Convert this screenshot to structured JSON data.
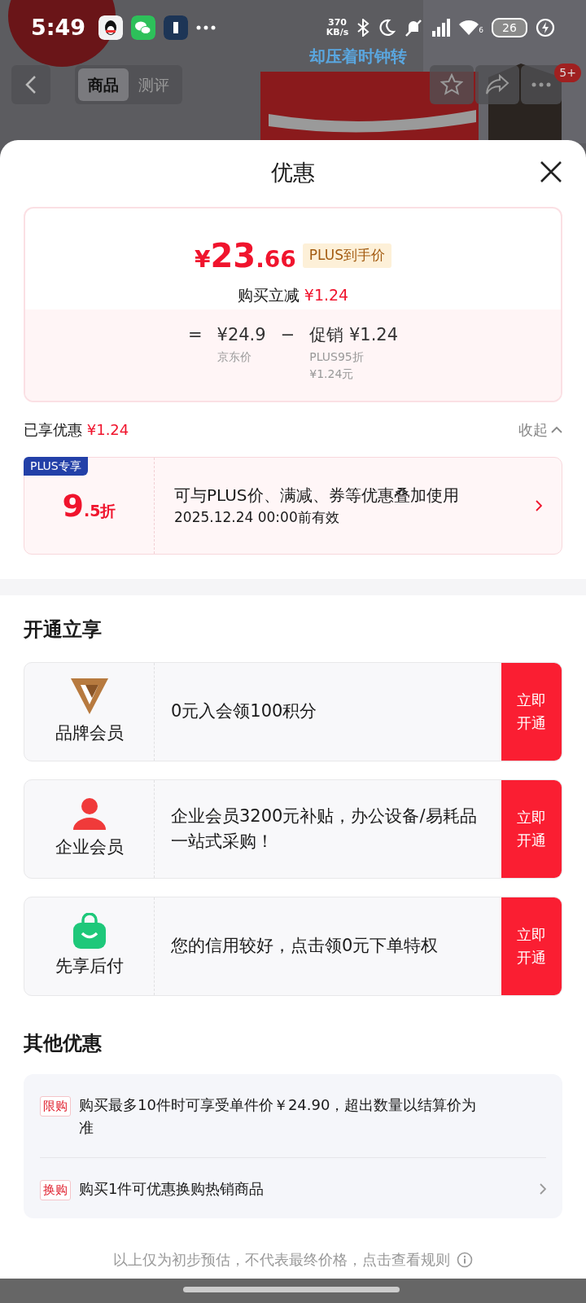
{
  "status_bar": {
    "time": "5:49",
    "speed_value": "370",
    "speed_unit": "KB/s",
    "wifi_label": "6",
    "battery": "26"
  },
  "floating_lyric": "却压着时钟转",
  "header": {
    "tabs": [
      {
        "label": "商品",
        "selected": true
      },
      {
        "label": "测评",
        "selected": false
      }
    ],
    "badge": "5+"
  },
  "sheet": {
    "title": "优惠"
  },
  "price_card": {
    "currency": "¥",
    "price_int": "23",
    "price_dec": ".66",
    "price_tag": "PLUS到手价",
    "reduce_label": "购买立减",
    "reduce_amount": "¥1.24",
    "equals": "=",
    "base_price": "¥24.9",
    "base_label": "京东价",
    "minus": "−",
    "promo_label": "促销",
    "promo_amount": "¥1.24",
    "promo_notes": [
      "PLUS95折",
      "¥1.24元"
    ]
  },
  "enjoyed": {
    "label": "已享优惠",
    "amount": "¥1.24",
    "collapse": "收起"
  },
  "plus_coupon": {
    "tag": "PLUS专享",
    "discount_int": "9",
    "discount_dec": ".5折",
    "title": "可与PLUS价、满减、券等优惠叠加使用",
    "validity": "2025.12.24 00:00前有效"
  },
  "open_section": {
    "title": "开通立享",
    "items": [
      {
        "kind": "brand",
        "name": "品牌会员",
        "text": "0元入会领100积分",
        "button": "立即开通"
      },
      {
        "kind": "enterprise",
        "name": "企业会员",
        "text": "企业会员3200元补贴，办公设备/易耗品一站式采购！",
        "button": "立即开通"
      },
      {
        "kind": "paylater",
        "name": "先享后付",
        "text": "您的信用较好，点击领0元下单特权",
        "button": "立即开通"
      }
    ]
  },
  "other_section": {
    "title": "其他优惠",
    "items": [
      {
        "tag": "限购",
        "text": "购买最多10件时可享受单件价￥24.90，超出数量以结算价为准",
        "arrow": false
      },
      {
        "tag": "换购",
        "text": "购买1件可优惠换购热销商品",
        "arrow": true
      }
    ]
  },
  "footer": "以上仅为初步预估，不代表最终价格，点击查看规则"
}
